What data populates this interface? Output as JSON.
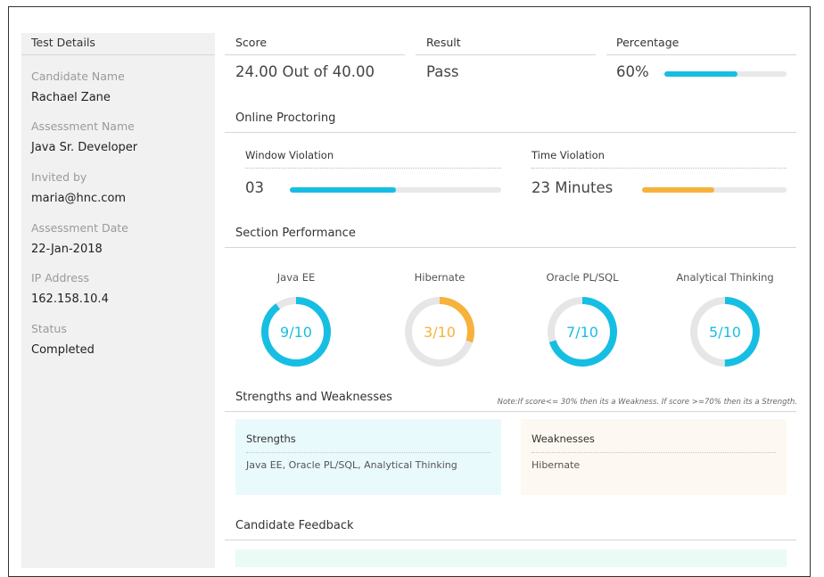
{
  "sidebar": {
    "title": "Test Details",
    "fields": [
      {
        "label": "Candidate Name",
        "value": "Rachael Zane"
      },
      {
        "label": "Assessment Name",
        "value": "Java Sr. Developer"
      },
      {
        "label": "Invited by",
        "value": "maria@hnc.com"
      },
      {
        "label": "Assessment Date",
        "value": "22-Jan-2018"
      },
      {
        "label": "IP Address",
        "value": "162.158.10.4"
      },
      {
        "label": "Status",
        "value": "Completed"
      }
    ]
  },
  "summary": {
    "score_label": "Score",
    "score_value": "24.00 Out of 40.00",
    "result_label": "Result",
    "result_value": "Pass",
    "percentage_label": "Percentage",
    "percentage_value": "60%",
    "percentage_fill": 0.6
  },
  "proctoring": {
    "title": "Online Proctoring",
    "window_violation": {
      "label": "Window Violation",
      "value": "03",
      "fill": 0.5
    },
    "time_violation": {
      "label": "Time Violation",
      "value": "23 Minutes",
      "fill": 0.5
    }
  },
  "section_performance": {
    "title": "Section Performance",
    "sections": [
      {
        "name": "Java EE",
        "score_text": "9/10",
        "fraction": 0.9,
        "color": "#17bee3"
      },
      {
        "name": "Hibernate",
        "score_text": "3/10",
        "fraction": 0.3,
        "color": "#f7b23b"
      },
      {
        "name": "Oracle PL/SQL",
        "score_text": "7/10",
        "fraction": 0.7,
        "color": "#17bee3"
      },
      {
        "name": "Analytical Thinking",
        "score_text": "5/10",
        "fraction": 0.5,
        "color": "#17bee3"
      }
    ]
  },
  "strengths_weaknesses": {
    "title": "Strengths and Weaknesses",
    "note": "Note:If score<= 30% then its a Weakness. If score >=70% then its a Strength.",
    "strengths_title": "Strengths",
    "strengths_text": "Java EE, Oracle PL/SQL, Analytical Thinking",
    "weaknesses_title": "Weaknesses",
    "weaknesses_text": "Hibernate"
  },
  "feedback": {
    "title": "Candidate Feedback"
  },
  "colors": {
    "accent_blue": "#17bee3",
    "accent_orange": "#f7b23b",
    "strengths_bg": "#e9fafd",
    "weaknesses_bg": "#fdf8f1",
    "feedback_bg": "#eafaf4"
  }
}
